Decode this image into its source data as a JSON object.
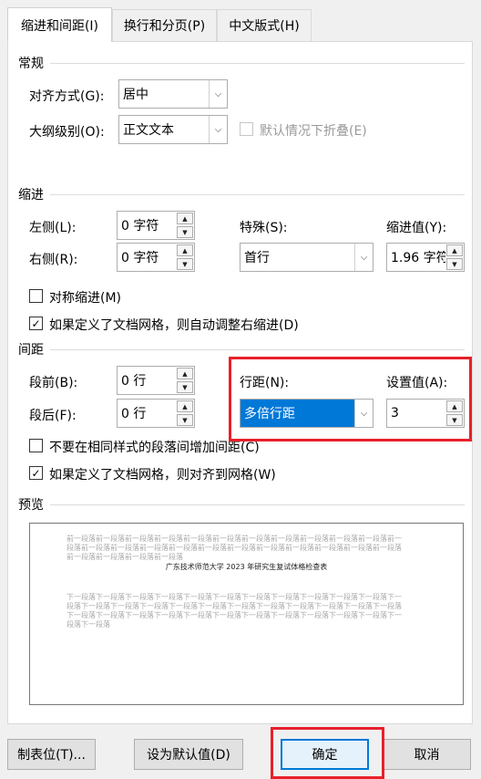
{
  "tabs": [
    {
      "label": "缩进和间距(I)",
      "active": true
    },
    {
      "label": "换行和分页(P)",
      "active": false
    },
    {
      "label": "中文版式(H)",
      "active": false
    }
  ],
  "general": {
    "section": "常规",
    "alignment_label": "对齐方式(G):",
    "alignment_value": "居中",
    "outline_label": "大纲级别(O):",
    "outline_value": "正文文本",
    "collapse_label": "默认情况下折叠(E)"
  },
  "indent": {
    "section": "缩进",
    "left_label": "左侧(L):",
    "left_value": "0 字符",
    "right_label": "右侧(R):",
    "right_value": "0 字符",
    "special_label": "特殊(S):",
    "special_value": "首行",
    "indent_value_label": "缩进值(Y):",
    "indent_value": "1.96 字符",
    "mirror_label": "对称缩进(M)",
    "mirror_checked": false,
    "auto_adjust_label": "如果定义了文档网格，则自动调整右缩进(D)",
    "auto_adjust_checked": true
  },
  "spacing": {
    "section": "间距",
    "before_label": "段前(B):",
    "before_value": "0 行",
    "after_label": "段后(F):",
    "after_value": "0 行",
    "line_spacing_label": "行距(N):",
    "line_spacing_value": "多倍行距",
    "set_value_label": "设置值(A):",
    "set_value": "3",
    "no_space_label": "不要在相同样式的段落间增加间距(C)",
    "no_space_checked": false,
    "snap_grid_label": "如果定义了文档网格，则对齐到网格(W)",
    "snap_grid_checked": true
  },
  "preview": {
    "section": "预览",
    "prev_text": "前一段落前一段落前一段落前一段落前一段落前一段落前一段落前一段落前一段落前一段落前一段落前一段落前一段落前一段落前一段落前一段落前一段落前一段落前一段落前一段落前一段落前一段落前一段落前一段落前一段落前一段落前一段落",
    "main_text": "广东技术师范大学 2023 年研究生复试体格检查表",
    "next_text": "下一段落下一段落下一段落下一段落下一段落下一段落下一段落下一段落下一段落下一段落下一段落下一段落下一段落下一段落下一段落下一段落下一段落下一段落下一段落下一段落下一段落下一段落下一段落下一段落下一段落下一段落下一段落下一段落下一段落下一段落下一段落下一段落下一段落下一段落下一段落下一段落"
  },
  "buttons": {
    "tabs": "制表位(T)...",
    "set_default": "设为默认值(D)",
    "ok": "确定",
    "cancel": "取消"
  },
  "icons": {
    "check": "✓",
    "dropdown": "⌵",
    "up": "▲",
    "down": "▼"
  },
  "colors": {
    "highlight": "#e8202a",
    "selection": "#0078d7"
  }
}
